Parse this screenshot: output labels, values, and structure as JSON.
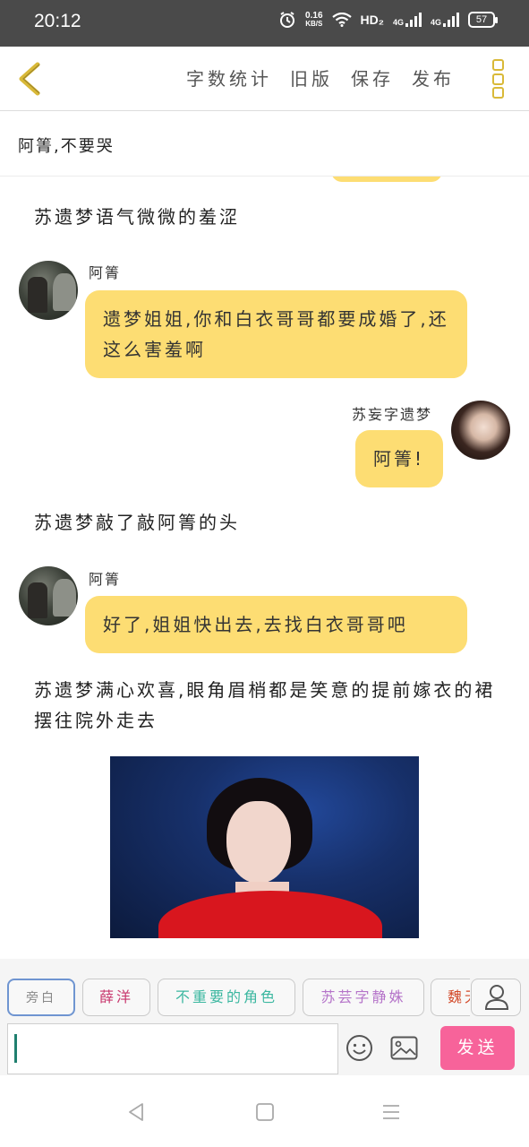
{
  "status_bar": {
    "time": "20:12",
    "net_speed_value": "0.16",
    "net_speed_unit": "KB/S",
    "hd_label": "HD₂",
    "sim1_label": "4G",
    "sim2_label": "4G",
    "battery": "57"
  },
  "toolbar": {
    "word_count": "字数统计",
    "old_version": "旧版",
    "save": "保存",
    "publish": "发布"
  },
  "title": "阿箐,不要哭",
  "messages": [
    {
      "type": "narration",
      "text": "苏遗梦语气微微的羞涩"
    },
    {
      "type": "left",
      "name": "阿箐",
      "text": "遗梦姐姐,你和白衣哥哥都要成婚了,还这么害羞啊"
    },
    {
      "type": "right",
      "name": "苏妄字遗梦",
      "text": "阿箐!"
    },
    {
      "type": "narration",
      "text": "苏遗梦敲了敲阿箐的头"
    },
    {
      "type": "left",
      "name": "阿箐",
      "text": "好了,姐姐快出去,去找白衣哥哥吧"
    },
    {
      "type": "narration",
      "text": "苏遗梦满心欢喜,眼角眉梢都是笑意的提前嫁衣的裙摆往院外走去"
    }
  ],
  "roles": [
    {
      "label": "旁白",
      "color": "#888888"
    },
    {
      "label": "薛洋",
      "color": "#c8386e"
    },
    {
      "label": "不重要的角色",
      "color": "#3bb7a0"
    },
    {
      "label": "苏芸字静姝",
      "color": "#b574c9"
    },
    {
      "label": "魏无",
      "color": "#d34a2a"
    }
  ],
  "input": {
    "value": "",
    "placeholder": ""
  },
  "send_label": "发送",
  "colors": {
    "bubble": "#fddd73",
    "send": "#f7639a",
    "accent": "#d9b938"
  }
}
